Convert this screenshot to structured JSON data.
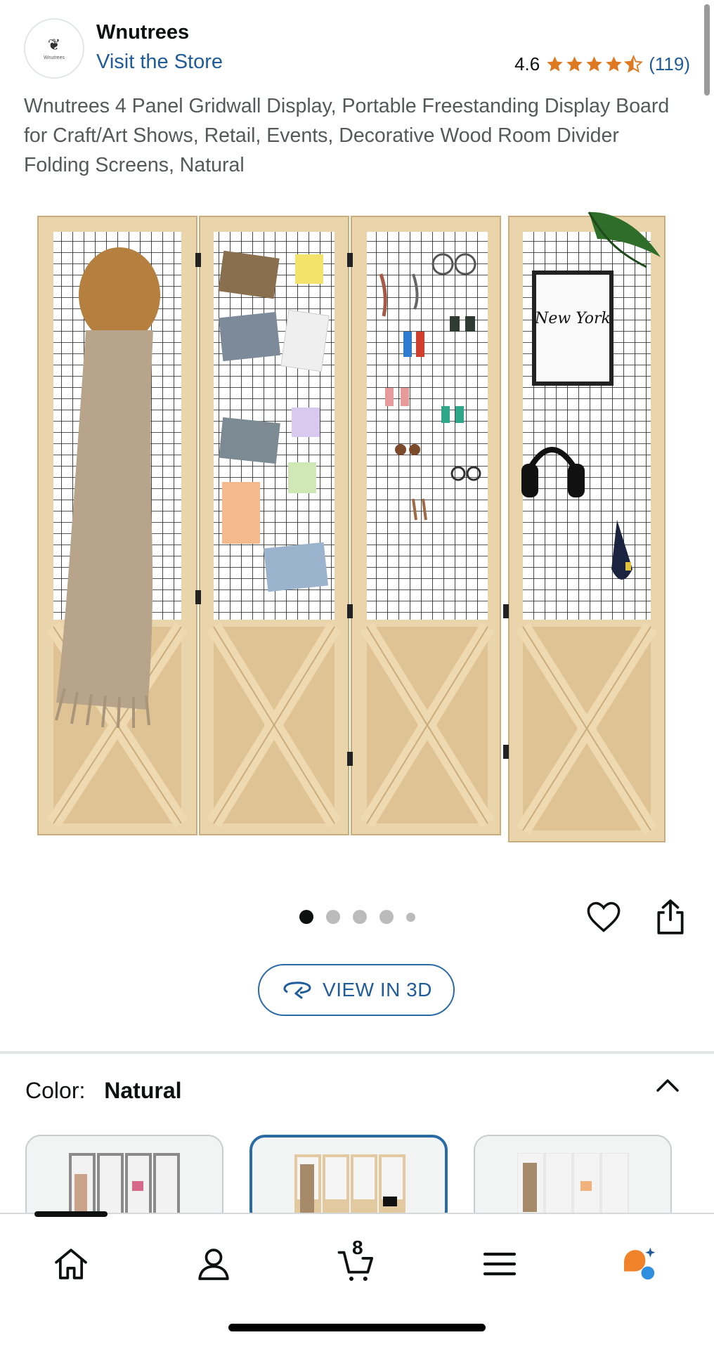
{
  "brand": {
    "name": "Wnutrees",
    "logo_text": "Wnutrees",
    "visit_store": "Visit the Store"
  },
  "rating": {
    "value": "4.6",
    "stars": 4.5,
    "count": "(119)"
  },
  "product": {
    "title": "Wnutrees 4 Panel Gridwall Display, Portable Freestanding Display Board for Craft/Art Shows, Retail, Events, Decorative Wood Room Divider Folding Screens, Natural",
    "image_alt": "four-panel-gridwall-room-divider",
    "new_york_print": "New York"
  },
  "carousel": {
    "count": 5,
    "active_index": 0
  },
  "view_3d": {
    "label": "VIEW IN 3D"
  },
  "variation": {
    "label": "Color:",
    "value": "Natural",
    "swatches": [
      {
        "name": "swatch-gray",
        "selected": false
      },
      {
        "name": "swatch-natural",
        "selected": true
      },
      {
        "name": "swatch-white",
        "selected": false
      }
    ]
  },
  "bottom_nav": {
    "items": [
      "home-icon",
      "account-icon",
      "cart-icon",
      "menu-icon",
      "rufus-icon"
    ],
    "cart_count": "8",
    "active": "home"
  },
  "colors": {
    "link": "#1f5c99",
    "star": "#de7921",
    "wood": "#e8d2a8",
    "active_border": "#2a6ba5"
  }
}
